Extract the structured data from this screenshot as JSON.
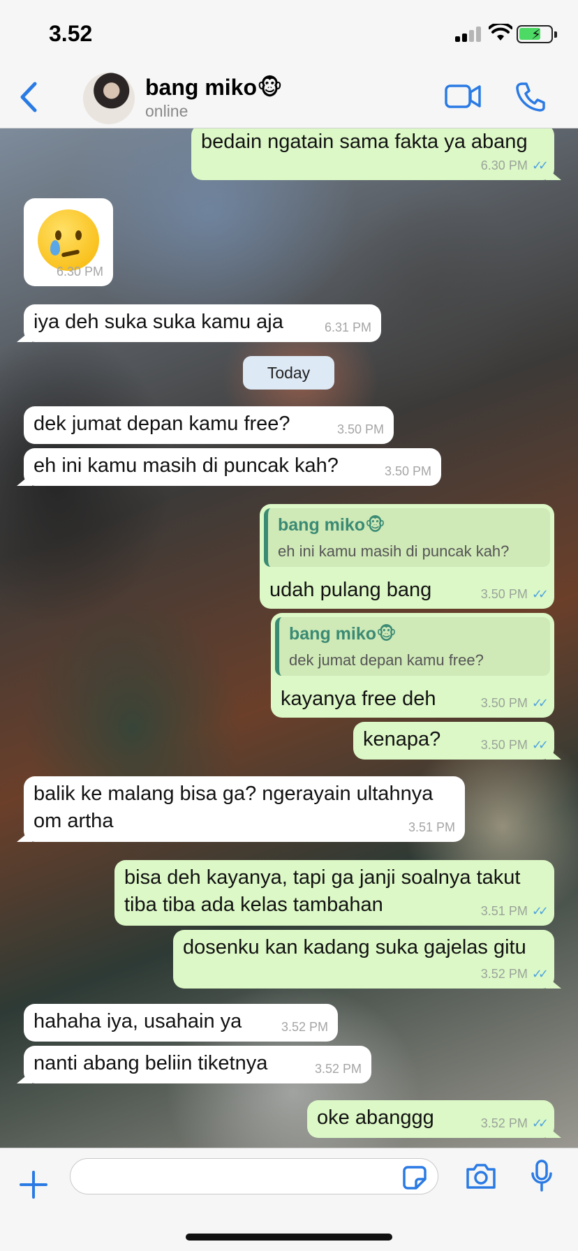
{
  "status_bar": {
    "time": "3.52"
  },
  "header": {
    "contact_name": "bang miko🐵",
    "contact_status": "online",
    "back_icon": "chevron-left-icon",
    "video_icon": "video-camera-icon",
    "call_icon": "phone-icon"
  },
  "colors": {
    "accent": "#2a7ae4",
    "outgoing_bubble": "#dcf8c6",
    "incoming_bubble": "#ffffff",
    "quote_name": "#3a8a74",
    "read_ticks": "#4fa3e0"
  },
  "messages": [
    {
      "direction": "out",
      "text": "bedain ngatain sama fakta ya abang",
      "time": "6.30 PM",
      "read": true
    },
    {
      "direction": "in",
      "emoji": "face-holding-back-tears",
      "time": "6.30 PM"
    },
    {
      "direction": "in",
      "text": "iya deh suka suka kamu aja",
      "time": "6.31 PM"
    },
    {
      "direction": "in",
      "text": "dek jumat depan kamu free?",
      "time": "3.50 PM"
    },
    {
      "direction": "in",
      "text": "eh ini kamu masih di puncak kah?",
      "time": "3.50 PM"
    },
    {
      "direction": "out",
      "quote_name": "bang miko🐵",
      "quote_text": "eh ini kamu masih di puncak kah?",
      "text": "udah pulang bang",
      "time": "3.50 PM",
      "read": true
    },
    {
      "direction": "out",
      "quote_name": "bang miko🐵",
      "quote_text": "dek jumat depan kamu free?",
      "text": "kayanya free deh",
      "time": "3.50 PM",
      "read": true
    },
    {
      "direction": "out",
      "text": "kenapa?",
      "time": "3.50 PM",
      "read": true
    },
    {
      "direction": "in",
      "text_line1": "balik ke malang bisa ga? ngerayain ultahnya",
      "text_line2": "om artha",
      "time": "3.51 PM"
    },
    {
      "direction": "out",
      "text_line1": "bisa deh kayanya, tapi ga janji soalnya takut",
      "text_line2": "tiba tiba ada kelas tambahan",
      "time": "3.51 PM",
      "read": true
    },
    {
      "direction": "out",
      "text": "dosenku kan kadang suka gajelas gitu",
      "time": "3.52 PM",
      "read": true
    },
    {
      "direction": "in",
      "text": "hahaha iya, usahain ya",
      "time": "3.52 PM"
    },
    {
      "direction": "in",
      "text": "nanti abang beliin tiketnya",
      "time": "3.52 PM"
    },
    {
      "direction": "out",
      "text": "oke abanggg",
      "time": "3.52 PM",
      "read": true
    }
  ],
  "date_divider": "Today",
  "input_bar": {
    "placeholder": "",
    "plus_icon": "plus-icon",
    "sticker_icon": "sticker-icon",
    "camera_icon": "camera-icon",
    "mic_icon": "microphone-icon"
  }
}
